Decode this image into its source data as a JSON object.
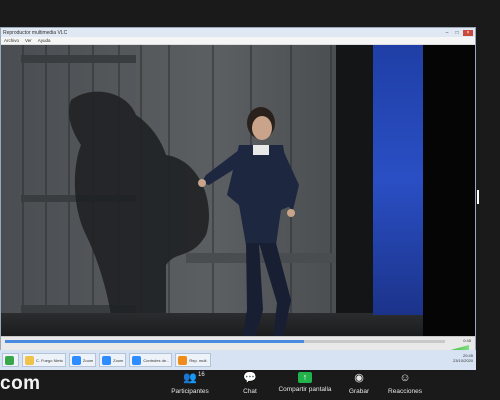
{
  "vlc": {
    "title": "Reproductor multimedia VLC",
    "menu": [
      "Archivo",
      "Ver",
      "Ayuda"
    ],
    "window_controls": [
      "–",
      "□",
      "×"
    ],
    "time": "0:45",
    "progress": 0.68
  },
  "taskbar": {
    "items": [
      {
        "label": "",
        "icon_color": "#3aa64a"
      },
      {
        "label": "C. Fuego Nieto",
        "icon_color": "#f0c24a"
      },
      {
        "label": "Zoom",
        "icon_color": "#2d8cff"
      },
      {
        "label": "Zoom",
        "icon_color": "#2d8cff"
      },
      {
        "label": "Controles de...",
        "icon_color": "#2d8cff"
      },
      {
        "label": "Rep. mult.",
        "icon_color": "#f08c1e"
      }
    ],
    "tray_time": "20:45",
    "tray_date": "23/10/2020"
  },
  "zoom": {
    "brand": "com",
    "buttons": [
      {
        "label": "Participantes",
        "icon": "participants-icon",
        "glyph": "👥",
        "count": "16"
      },
      {
        "label": "Chat",
        "icon": "chat-icon",
        "glyph": "💬"
      },
      {
        "label": "Compartir pantalla",
        "icon": "share-screen-icon",
        "glyph": "↑"
      },
      {
        "label": "Grabar",
        "icon": "record-icon",
        "glyph": "◉"
      },
      {
        "label": "Reacciones",
        "icon": "reactions-icon",
        "glyph": "☺"
      }
    ]
  }
}
